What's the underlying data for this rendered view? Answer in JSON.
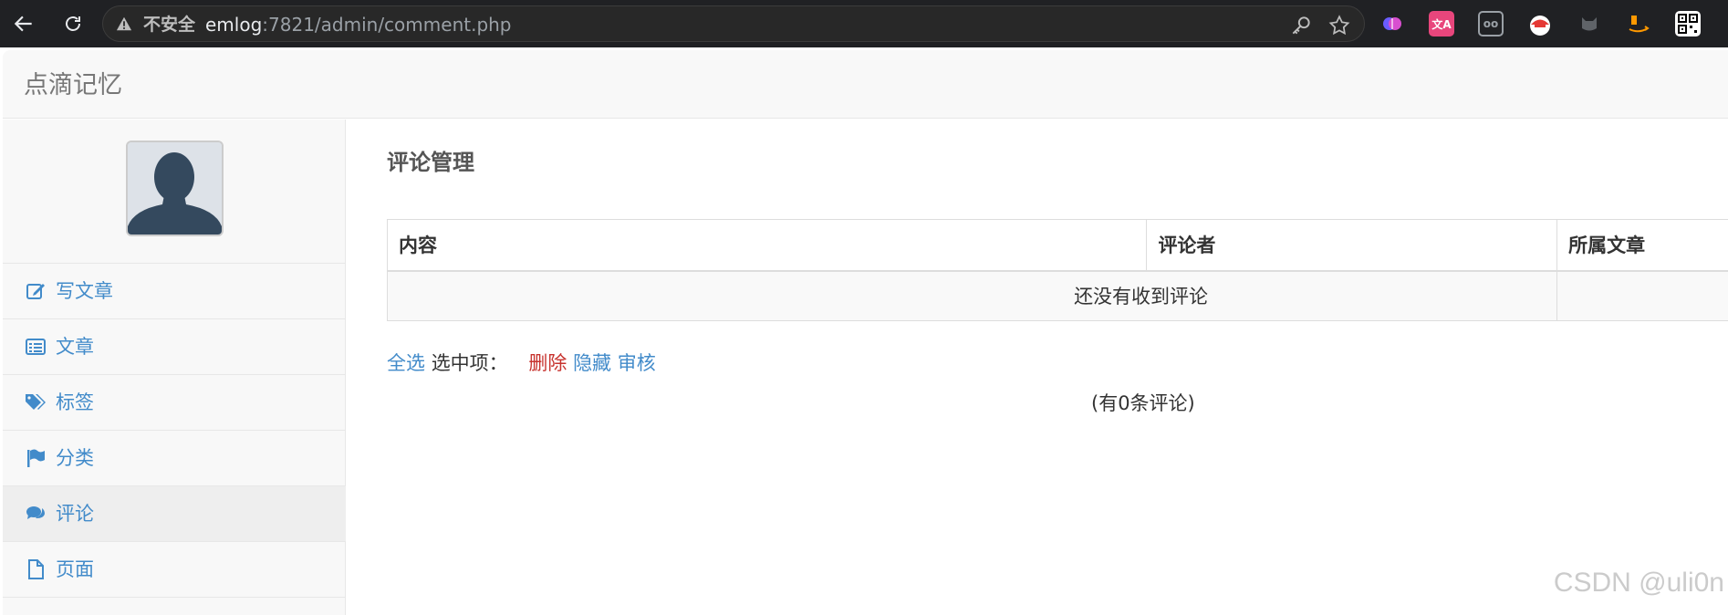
{
  "browser": {
    "insecure_label": "不安全",
    "url_host": "emlog",
    "url_rest": ":7821/admin/comment.php"
  },
  "extensions": [
    {
      "name": "brain-extension-icon",
      "glyph": "",
      "color": "#7b61ff"
    },
    {
      "name": "translate-extension-icon",
      "glyph": "文A",
      "color": "#e8467c"
    },
    {
      "name": "glasses-extension-icon",
      "glyph": "oo",
      "color": "#5f6368"
    },
    {
      "name": "tomato-extension-icon",
      "glyph": "",
      "color": "#e53935"
    },
    {
      "name": "cat-extension-icon",
      "glyph": "",
      "color": "#5f6368"
    },
    {
      "name": "amazon-extension-icon",
      "glyph": "",
      "color": "#ff9900"
    },
    {
      "name": "qr-code-extension-icon",
      "glyph": "",
      "color": "#ffffff"
    }
  ],
  "site": {
    "title": "点滴记忆"
  },
  "sidebar": {
    "items": [
      {
        "label": "写文章",
        "icon": "edit-icon"
      },
      {
        "label": "文章",
        "icon": "list-icon"
      },
      {
        "label": "标签",
        "icon": "tags-icon"
      },
      {
        "label": "分类",
        "icon": "flag-icon"
      },
      {
        "label": "评论",
        "icon": "comments-icon",
        "active": true
      },
      {
        "label": "页面",
        "icon": "file-icon"
      }
    ]
  },
  "main": {
    "title": "评论管理",
    "table": {
      "headers": [
        "内容",
        "评论者",
        "所属文章"
      ],
      "empty_message": "还没有收到评论"
    },
    "batch": {
      "select_all": "全选",
      "selected_label": "选中项：",
      "delete": "删除",
      "hide": "隐藏",
      "approve": "审核"
    },
    "count_text": "(有0条评论)"
  },
  "watermark": "CSDN @uli0n"
}
